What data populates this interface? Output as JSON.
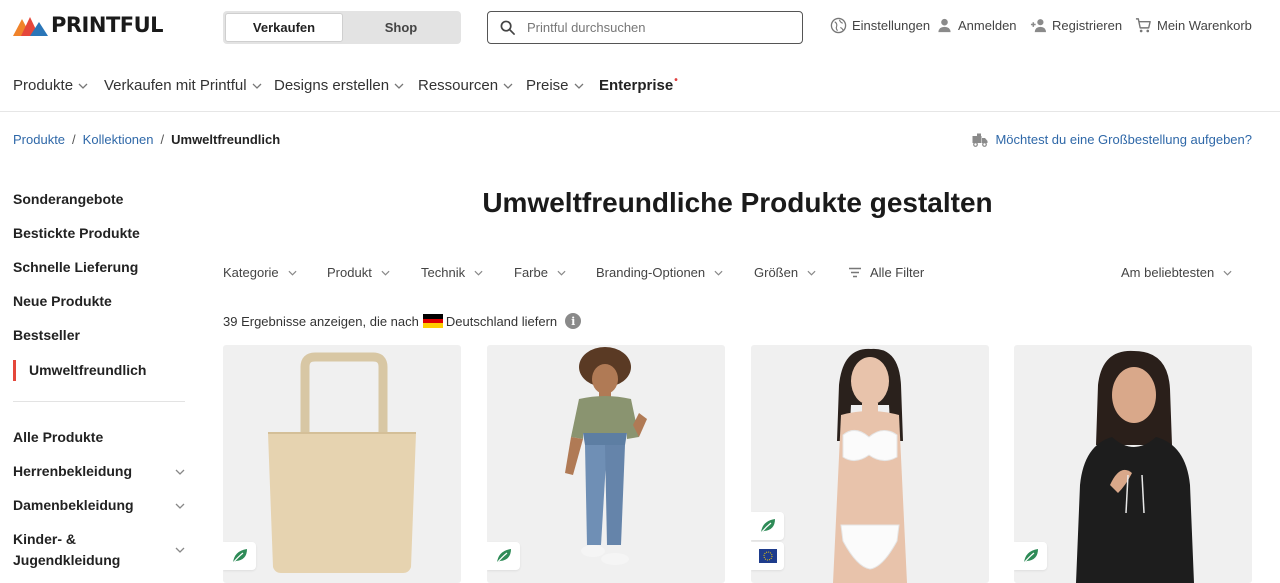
{
  "brand": {
    "name": "PRINTFUL",
    "colors": {
      "red": "#e5473b",
      "orange": "#f0832a",
      "blue": "#2a76b8",
      "link": "#2f68a8"
    }
  },
  "mode_toggle": {
    "options": [
      "Verkaufen",
      "Shop"
    ],
    "selected": "Verkaufen"
  },
  "search": {
    "placeholder": "Printful durchsuchen",
    "value": "",
    "icon": "search-icon"
  },
  "utility": {
    "settings": "Einstellungen",
    "login": "Anmelden",
    "register": "Registrieren",
    "cart": "Mein Warenkorb"
  },
  "nav": [
    {
      "label": "Produkte"
    },
    {
      "label": "Verkaufen mit Printful"
    },
    {
      "label": "Designs erstellen"
    },
    {
      "label": "Ressourcen"
    },
    {
      "label": "Preise"
    },
    {
      "label": "Enterprise",
      "marker": "•"
    }
  ],
  "breadcrumb": {
    "items": [
      "Produkte",
      "Kollektionen"
    ],
    "current": "Umweltfreundlich",
    "separator": "/"
  },
  "bulk_order": "Möchtest du eine Großbestellung aufgeben?",
  "sidebar": {
    "top": [
      "Sonderangebote",
      "Bestickte Produkte",
      "Schnelle Lieferung",
      "Neue Produkte",
      "Bestseller",
      "Umweltfreundlich"
    ],
    "active": "Umweltfreundlich",
    "categories": [
      "Alle Produkte",
      "Herrenbekleidung",
      "Damenbekleidung",
      "Kinder- &",
      "Jugendkleidung"
    ]
  },
  "page_title": "Umweltfreundliche Produkte gestalten",
  "filters": [
    "Kategorie",
    "Produkt",
    "Technik",
    "Farbe",
    "Branding-Optionen",
    "Größen",
    "Alle Filter"
  ],
  "sort": "Am beliebtesten",
  "results": {
    "prefix": "39 Ergebnisse anzeigen, die nach",
    "country": "Deutschland liefern",
    "info": "i"
  },
  "products": [
    {
      "name": "eco-tote-bag",
      "badges": [
        "eco-leaf-icon"
      ]
    },
    {
      "name": "olive-t-shirt-model",
      "badges": [
        "eco-leaf-icon"
      ]
    },
    {
      "name": "white-bikini-model",
      "badges": [
        "eco-leaf-icon",
        "eu-flag-icon"
      ]
    },
    {
      "name": "black-hoodie-model",
      "badges": [
        "eco-leaf-icon"
      ]
    }
  ]
}
